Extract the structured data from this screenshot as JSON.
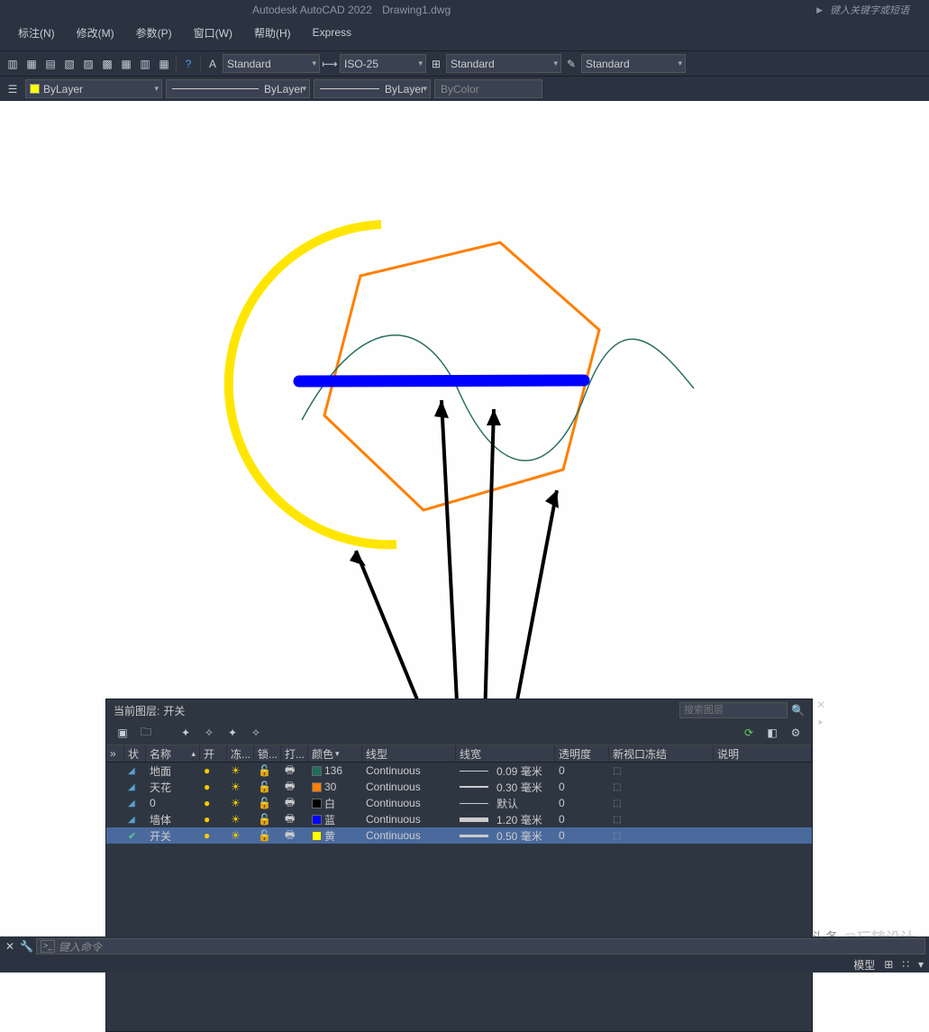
{
  "title": {
    "app": "Autodesk AutoCAD 2022",
    "file": "Drawing1.dwg",
    "search_hint": "键入关键字或短语"
  },
  "menu": {
    "dim": "标注(N)",
    "modify": "修改(M)",
    "param": "参数(P)",
    "window": "窗口(W)",
    "help": "帮助(H)",
    "express": "Express"
  },
  "toolbar": {
    "textstyle": "Standard",
    "dimstyle": "ISO-25",
    "tablestyle": "Standard",
    "mlstyle": "Standard"
  },
  "props": {
    "layer": "ByLayer",
    "linetype": "ByLayer",
    "lineweight": "ByLayer",
    "color": "ByColor"
  },
  "layerpanel": {
    "current_label": "当前图层:",
    "current": "开关",
    "search_ph": "搜索图层",
    "cols": {
      "status": "状",
      "name": "名称",
      "on": "开",
      "freeze": "冻...",
      "lock": "锁...",
      "plot": "打...",
      "color": "颜色",
      "ltype": "线型",
      "lweight": "线宽",
      "trans": "透明度",
      "vpfreeze": "新视口冻结",
      "desc": "说明"
    },
    "rows": [
      {
        "name": "地面",
        "colorName": "136",
        "colorHex": "#1e6e5a",
        "ltype": "Continuous",
        "lw": "0.09 毫米",
        "lwpx": 1,
        "trans": "0"
      },
      {
        "name": "天花",
        "colorName": "30",
        "colorHex": "#ff7f00",
        "ltype": "Continuous",
        "lw": "0.30 毫米",
        "lwpx": 2,
        "trans": "0"
      },
      {
        "name": "0",
        "colorName": "白",
        "colorHex": "#000000",
        "ltype": "Continuous",
        "lw": "默认",
        "lwpx": 1,
        "trans": "0"
      },
      {
        "name": "墙体",
        "colorName": "蓝",
        "colorHex": "#0000ff",
        "ltype": "Continuous",
        "lw": "1.20 毫米",
        "lwpx": 5,
        "trans": "0"
      },
      {
        "name": "开关",
        "colorName": "黄",
        "colorHex": "#ffff00",
        "ltype": "Continuous",
        "lw": "0.50 毫米",
        "lwpx": 3,
        "trans": "0"
      }
    ]
  },
  "cmd": {
    "placeholder": "键入命令"
  },
  "watermark": {
    "prefix": "头条",
    "handle": "@玩转设计"
  },
  "status": {
    "model": "模型"
  }
}
